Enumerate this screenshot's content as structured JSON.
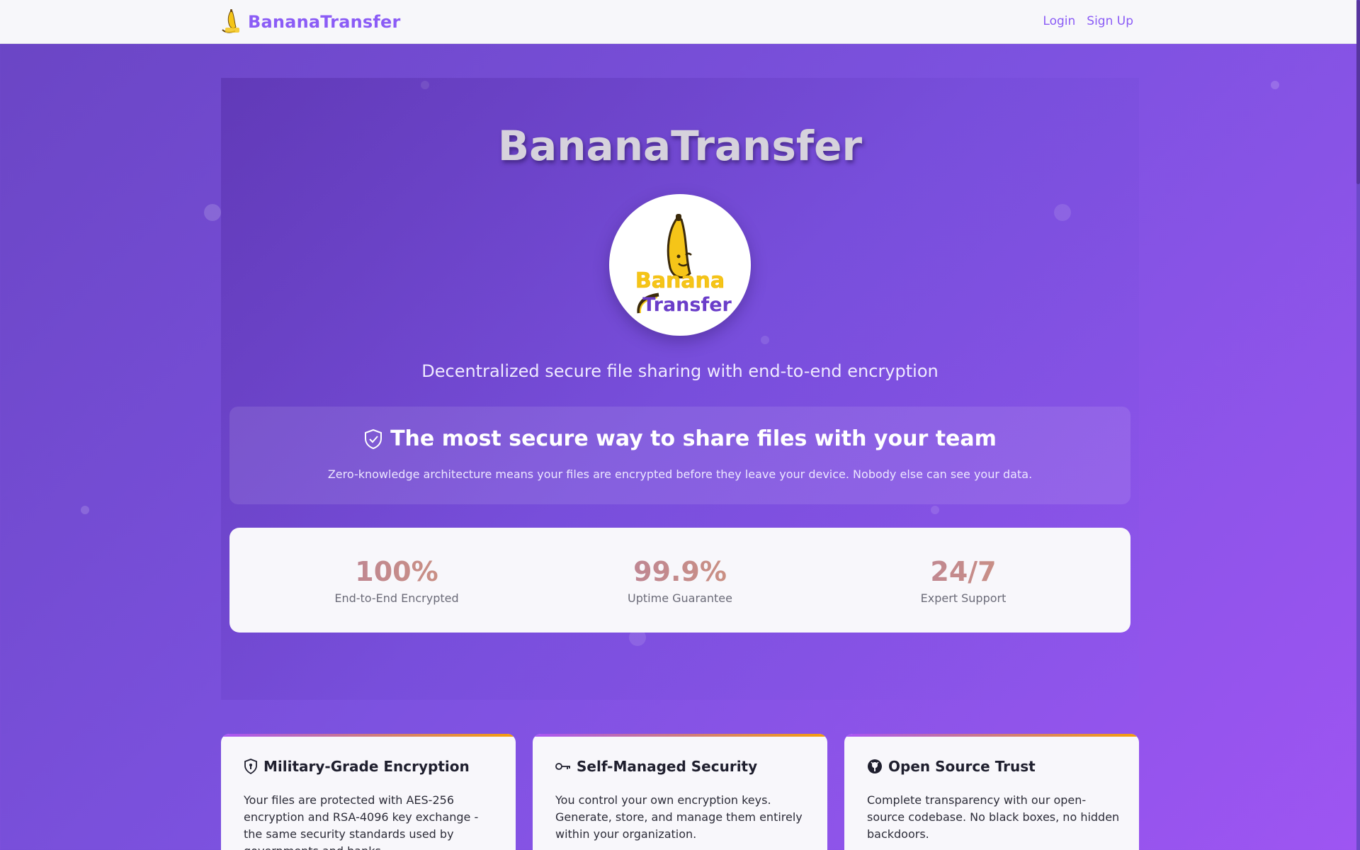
{
  "nav": {
    "brand": "BananaTransfer",
    "logo_icon": "banana-logo-icon",
    "login": "Login",
    "signup": "Sign Up"
  },
  "hero": {
    "title": "BananaTransfer",
    "logo_top": "Banana",
    "logo_bottom": "Transfer",
    "subtitle": "Decentralized secure file sharing with end-to-end encryption",
    "security_heading": "The most secure way to share files with your team",
    "security_icon": "shield-check-icon",
    "security_desc": "Zero-knowledge architecture means your files are encrypted before they leave your device. Nobody else can see your data."
  },
  "stats": [
    {
      "value": "100%",
      "label": "End-to-End Encrypted"
    },
    {
      "value": "99.9%",
      "label": "Uptime Guarantee"
    },
    {
      "value": "24/7",
      "label": "Expert Support"
    }
  ],
  "features": [
    {
      "icon": "shield-lock-icon",
      "title": "Military-Grade Encryption",
      "desc": "Your files are protected with AES-256 encryption and RSA-4096 key exchange - the same security standards used by governments and banks."
    },
    {
      "icon": "key-icon",
      "title": "Self-Managed Security",
      "desc": "You control your own encryption keys. Generate, store, and manage them entirely within your organization."
    },
    {
      "icon": "github-icon",
      "title": "Open Source Trust",
      "desc": "Complete transparency with our open-source codebase. No black boxes, no hidden backdoors."
    }
  ],
  "colors": {
    "brand": "#8b5cf6",
    "banana": "#f5c518",
    "accent_gradient_start": "#a855f7",
    "accent_gradient_end": "#f59e0b"
  }
}
